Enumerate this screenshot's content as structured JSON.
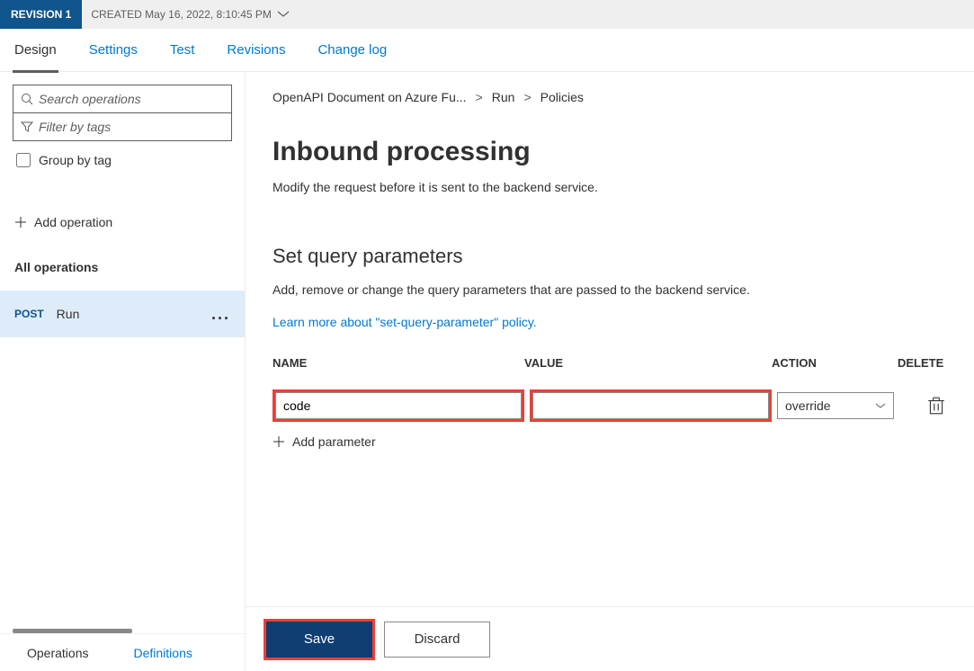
{
  "top": {
    "revision_label": "REVISION 1",
    "created_label": "CREATED May 16, 2022, 8:10:45 PM"
  },
  "tabs": {
    "design": "Design",
    "settings": "Settings",
    "test": "Test",
    "revisions": "Revisions",
    "changelog": "Change log"
  },
  "sidebar": {
    "search_placeholder": "Search operations",
    "filter_placeholder": "Filter by tags",
    "group_by_tag": "Group by tag",
    "add_operation": "Add operation",
    "all_operations": "All operations",
    "op_method": "POST",
    "op_name": "Run",
    "bottom_tabs": {
      "operations": "Operations",
      "definitions": "Definitions"
    }
  },
  "breadcrumb": {
    "a": "OpenAPI Document on Azure Fu...",
    "b": "Run",
    "c": "Policies"
  },
  "main": {
    "h1": "Inbound processing",
    "desc": "Modify the request before it is sent to the backend service.",
    "h2": "Set query parameters",
    "sub": "Add, remove or change the query parameters that are passed to the backend service.",
    "learn": "Learn more about \"set-query-parameter\" policy.",
    "table": {
      "col_name": "NAME",
      "col_value": "VALUE",
      "col_action": "ACTION",
      "col_delete": "DELETE",
      "row": {
        "name": "code",
        "value": "",
        "action": "override"
      }
    },
    "add_parameter": "Add parameter",
    "save": "Save",
    "discard": "Discard"
  }
}
